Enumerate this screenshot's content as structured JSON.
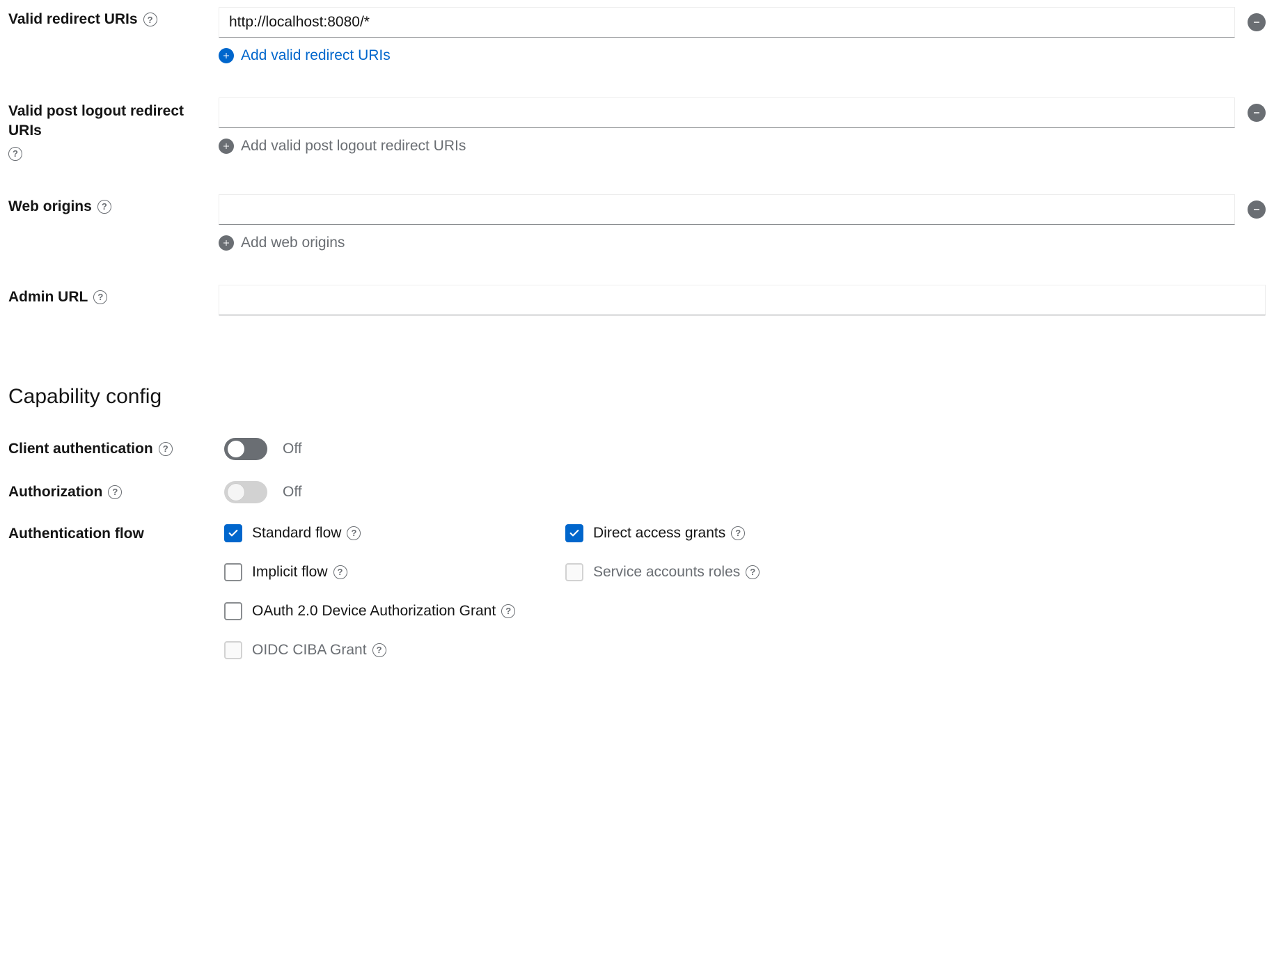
{
  "fields": {
    "validRedirectUris": {
      "label": "Valid redirect URIs",
      "value": "http://localhost:8080/*",
      "addLabel": "Add valid redirect URIs"
    },
    "validPostLogoutRedirectUris": {
      "label": "Valid post logout redirect URIs",
      "value": "",
      "addLabel": "Add valid post logout redirect URIs"
    },
    "webOrigins": {
      "label": "Web origins",
      "value": "",
      "addLabel": "Add web origins"
    },
    "adminUrl": {
      "label": "Admin URL",
      "value": ""
    }
  },
  "capability": {
    "sectionTitle": "Capability config",
    "clientAuth": {
      "label": "Client authentication",
      "state": "Off"
    },
    "authorization": {
      "label": "Authorization",
      "state": "Off"
    },
    "authFlowLabel": "Authentication flow",
    "flows": {
      "standard": {
        "label": "Standard flow",
        "checked": true,
        "disabled": false
      },
      "directAccess": {
        "label": "Direct access grants",
        "checked": true,
        "disabled": false
      },
      "implicit": {
        "label": "Implicit flow",
        "checked": false,
        "disabled": false
      },
      "serviceAccounts": {
        "label": "Service accounts roles",
        "checked": false,
        "disabled": true
      },
      "deviceAuth": {
        "label": "OAuth 2.0 Device Authorization Grant",
        "checked": false,
        "disabled": false
      },
      "ciba": {
        "label": "OIDC CIBA Grant",
        "checked": false,
        "disabled": true
      }
    }
  }
}
